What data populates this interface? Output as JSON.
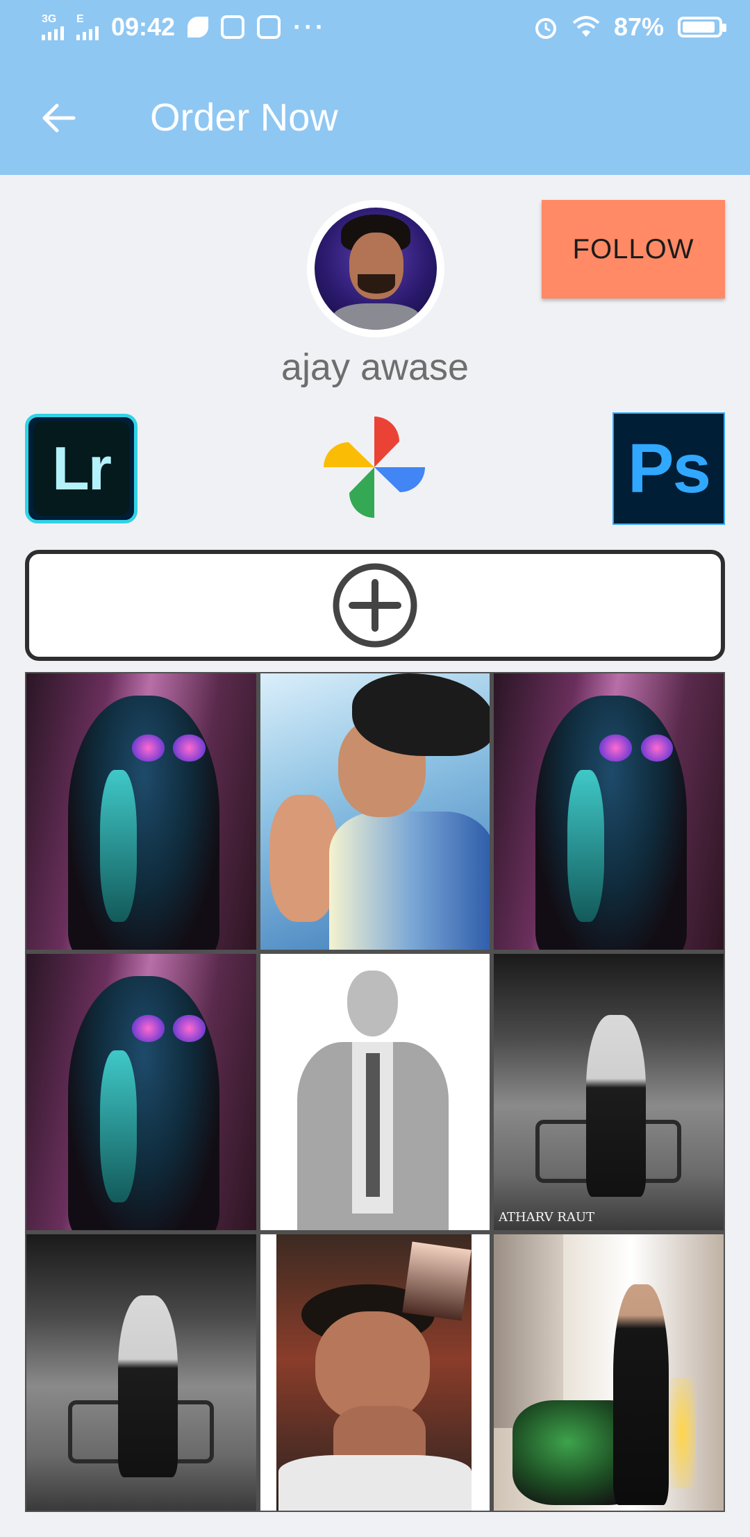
{
  "status_bar": {
    "net1": "3G",
    "net2": "E",
    "time": "09:42",
    "more": "···",
    "battery": "87%"
  },
  "app_bar": {
    "title": "Order Now"
  },
  "profile": {
    "username": "ajay awase",
    "follow_label": "FOLLOW"
  },
  "apps": {
    "lr_label": "Lr",
    "ps_label": "Ps"
  },
  "gallery": {
    "watermark": "ATHARV RAUT"
  },
  "colors": {
    "app_bar": "#8fc7f3",
    "follow_button": "#ff8a65",
    "background": "#f0f1f4"
  }
}
